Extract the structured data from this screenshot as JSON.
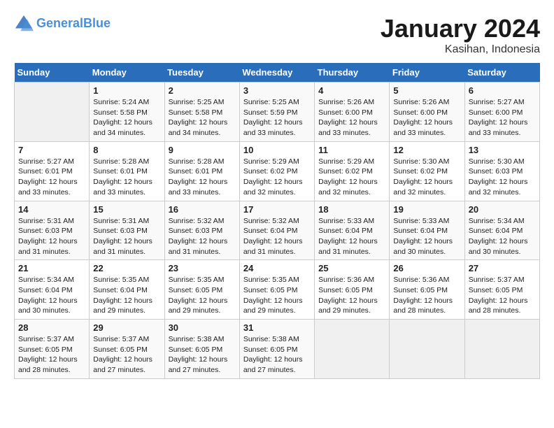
{
  "header": {
    "logo_line1": "General",
    "logo_line2": "Blue",
    "month_title": "January 2024",
    "location": "Kasihan, Indonesia"
  },
  "days_of_week": [
    "Sunday",
    "Monday",
    "Tuesday",
    "Wednesday",
    "Thursday",
    "Friday",
    "Saturday"
  ],
  "weeks": [
    [
      {
        "num": "",
        "content": ""
      },
      {
        "num": "1",
        "content": "Sunrise: 5:24 AM\nSunset: 5:58 PM\nDaylight: 12 hours\nand 34 minutes."
      },
      {
        "num": "2",
        "content": "Sunrise: 5:25 AM\nSunset: 5:58 PM\nDaylight: 12 hours\nand 34 minutes."
      },
      {
        "num": "3",
        "content": "Sunrise: 5:25 AM\nSunset: 5:59 PM\nDaylight: 12 hours\nand 33 minutes."
      },
      {
        "num": "4",
        "content": "Sunrise: 5:26 AM\nSunset: 6:00 PM\nDaylight: 12 hours\nand 33 minutes."
      },
      {
        "num": "5",
        "content": "Sunrise: 5:26 AM\nSunset: 6:00 PM\nDaylight: 12 hours\nand 33 minutes."
      },
      {
        "num": "6",
        "content": "Sunrise: 5:27 AM\nSunset: 6:00 PM\nDaylight: 12 hours\nand 33 minutes."
      }
    ],
    [
      {
        "num": "7",
        "content": "Sunrise: 5:27 AM\nSunset: 6:01 PM\nDaylight: 12 hours\nand 33 minutes."
      },
      {
        "num": "8",
        "content": "Sunrise: 5:28 AM\nSunset: 6:01 PM\nDaylight: 12 hours\nand 33 minutes."
      },
      {
        "num": "9",
        "content": "Sunrise: 5:28 AM\nSunset: 6:01 PM\nDaylight: 12 hours\nand 33 minutes."
      },
      {
        "num": "10",
        "content": "Sunrise: 5:29 AM\nSunset: 6:02 PM\nDaylight: 12 hours\nand 32 minutes."
      },
      {
        "num": "11",
        "content": "Sunrise: 5:29 AM\nSunset: 6:02 PM\nDaylight: 12 hours\nand 32 minutes."
      },
      {
        "num": "12",
        "content": "Sunrise: 5:30 AM\nSunset: 6:02 PM\nDaylight: 12 hours\nand 32 minutes."
      },
      {
        "num": "13",
        "content": "Sunrise: 5:30 AM\nSunset: 6:03 PM\nDaylight: 12 hours\nand 32 minutes."
      }
    ],
    [
      {
        "num": "14",
        "content": "Sunrise: 5:31 AM\nSunset: 6:03 PM\nDaylight: 12 hours\nand 31 minutes."
      },
      {
        "num": "15",
        "content": "Sunrise: 5:31 AM\nSunset: 6:03 PM\nDaylight: 12 hours\nand 31 minutes."
      },
      {
        "num": "16",
        "content": "Sunrise: 5:32 AM\nSunset: 6:03 PM\nDaylight: 12 hours\nand 31 minutes."
      },
      {
        "num": "17",
        "content": "Sunrise: 5:32 AM\nSunset: 6:04 PM\nDaylight: 12 hours\nand 31 minutes."
      },
      {
        "num": "18",
        "content": "Sunrise: 5:33 AM\nSunset: 6:04 PM\nDaylight: 12 hours\nand 31 minutes."
      },
      {
        "num": "19",
        "content": "Sunrise: 5:33 AM\nSunset: 6:04 PM\nDaylight: 12 hours\nand 30 minutes."
      },
      {
        "num": "20",
        "content": "Sunrise: 5:34 AM\nSunset: 6:04 PM\nDaylight: 12 hours\nand 30 minutes."
      }
    ],
    [
      {
        "num": "21",
        "content": "Sunrise: 5:34 AM\nSunset: 6:04 PM\nDaylight: 12 hours\nand 30 minutes."
      },
      {
        "num": "22",
        "content": "Sunrise: 5:35 AM\nSunset: 6:04 PM\nDaylight: 12 hours\nand 29 minutes."
      },
      {
        "num": "23",
        "content": "Sunrise: 5:35 AM\nSunset: 6:05 PM\nDaylight: 12 hours\nand 29 minutes."
      },
      {
        "num": "24",
        "content": "Sunrise: 5:35 AM\nSunset: 6:05 PM\nDaylight: 12 hours\nand 29 minutes."
      },
      {
        "num": "25",
        "content": "Sunrise: 5:36 AM\nSunset: 6:05 PM\nDaylight: 12 hours\nand 29 minutes."
      },
      {
        "num": "26",
        "content": "Sunrise: 5:36 AM\nSunset: 6:05 PM\nDaylight: 12 hours\nand 28 minutes."
      },
      {
        "num": "27",
        "content": "Sunrise: 5:37 AM\nSunset: 6:05 PM\nDaylight: 12 hours\nand 28 minutes."
      }
    ],
    [
      {
        "num": "28",
        "content": "Sunrise: 5:37 AM\nSunset: 6:05 PM\nDaylight: 12 hours\nand 28 minutes."
      },
      {
        "num": "29",
        "content": "Sunrise: 5:37 AM\nSunset: 6:05 PM\nDaylight: 12 hours\nand 27 minutes."
      },
      {
        "num": "30",
        "content": "Sunrise: 5:38 AM\nSunset: 6:05 PM\nDaylight: 12 hours\nand 27 minutes."
      },
      {
        "num": "31",
        "content": "Sunrise: 5:38 AM\nSunset: 6:05 PM\nDaylight: 12 hours\nand 27 minutes."
      },
      {
        "num": "",
        "content": ""
      },
      {
        "num": "",
        "content": ""
      },
      {
        "num": "",
        "content": ""
      }
    ]
  ]
}
